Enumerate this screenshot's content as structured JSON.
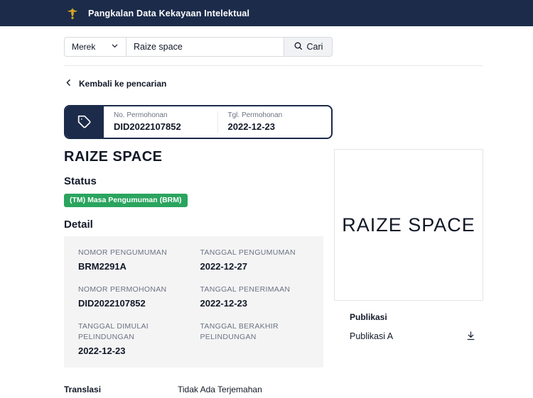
{
  "theme": {
    "navy": "#1c2b4a",
    "badge_green": "#2aa45e",
    "panel_gray": "#f4f4f5",
    "logo_gold": "#d6a622"
  },
  "header": {
    "title": "Pangkalan Data Kekayaan Intelektual"
  },
  "search": {
    "category_label": "Merek",
    "query": "Raize space",
    "button_label": "Cari"
  },
  "back": {
    "label": "Kembali ke pencarian"
  },
  "card": {
    "no_label": "No. Permohonan",
    "no_value": "DID2022107852",
    "date_label": "Tgl. Permohonan",
    "date_value": "2022-12-23"
  },
  "record": {
    "title": "RAIZE SPACE",
    "status_heading": "Status",
    "status_badge": "(TM) Masa Pengumuman (BRM)",
    "detail_heading": "Detail",
    "details": [
      {
        "label": "NOMOR PENGUMUMAN",
        "value": "BRM2291A"
      },
      {
        "label": "TANGGAL PENGUMUMAN",
        "value": "2022-12-27"
      },
      {
        "label": "NOMOR PERMOHONAN",
        "value": "DID2022107852"
      },
      {
        "label": "TANGGAL PENERIMAAN",
        "value": "2022-12-23"
      },
      {
        "label": "TANGGAL DIMULAI PELINDUNGAN",
        "value": "2022-12-23"
      },
      {
        "label": "TANGGAL BERAKHIR PELINDUNGAN",
        "value": ""
      }
    ]
  },
  "mark": {
    "text": "RAIZE SPACE"
  },
  "publikasi": {
    "heading": "Publikasi",
    "item": "Publikasi A"
  },
  "translasi": {
    "heading": "Translasi",
    "value": "Tidak Ada Terjemahan"
  }
}
